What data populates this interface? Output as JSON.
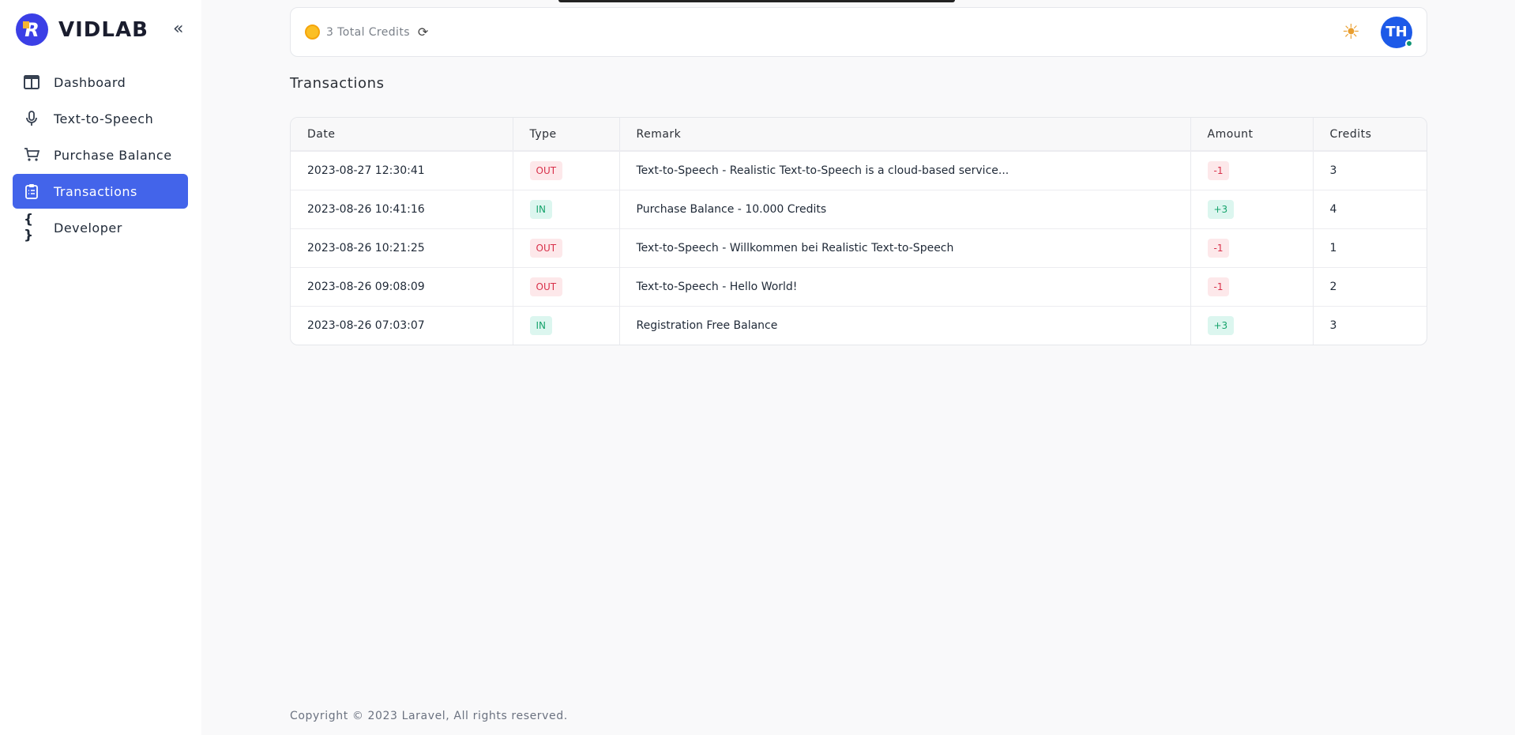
{
  "brand": {
    "name": "VIDLAB",
    "logo_letter": "R"
  },
  "sidebar": {
    "collapse_icon": "«",
    "items": [
      {
        "label": "Dashboard",
        "icon": "layout-icon",
        "active": false
      },
      {
        "label": "Text-to-Speech",
        "icon": "microphone-icon",
        "active": false
      },
      {
        "label": "Purchase Balance",
        "icon": "cart-icon",
        "active": false
      },
      {
        "label": "Transactions",
        "icon": "clipboard-list-icon",
        "active": true
      },
      {
        "label": "Developer",
        "icon": "braces-icon",
        "active": false
      }
    ]
  },
  "header": {
    "credits_label": "3 Total Credits",
    "avatar_initials": "TH"
  },
  "page": {
    "title": "Transactions"
  },
  "table": {
    "columns": [
      "Date",
      "Type",
      "Remark",
      "Amount",
      "Credits"
    ],
    "rows": [
      {
        "date": "2023-08-27 12:30:41",
        "type": "OUT",
        "remark": "Text-to-Speech - Realistic Text-to-Speech is a cloud-based service...",
        "amount": "-1",
        "credits": "3"
      },
      {
        "date": "2023-08-26 10:41:16",
        "type": "IN",
        "remark": "Purchase Balance - 10.000 Credits",
        "amount": "+3",
        "credits": "4"
      },
      {
        "date": "2023-08-26 10:21:25",
        "type": "OUT",
        "remark": "Text-to-Speech - Willkommen bei Realistic Text-to-Speech",
        "amount": "-1",
        "credits": "1"
      },
      {
        "date": "2023-08-26 09:08:09",
        "type": "OUT",
        "remark": "Text-to-Speech - Hello World!",
        "amount": "-1",
        "credits": "2"
      },
      {
        "date": "2023-08-26 07:03:07",
        "type": "IN",
        "remark": "Registration Free Balance",
        "amount": "+3",
        "credits": "3"
      }
    ]
  },
  "footer": {
    "text": "Copyright © 2023 Laravel, All rights reserved."
  },
  "colors": {
    "accent": "#4364ea",
    "negative": "#d8304a",
    "positive": "#15a36b"
  }
}
